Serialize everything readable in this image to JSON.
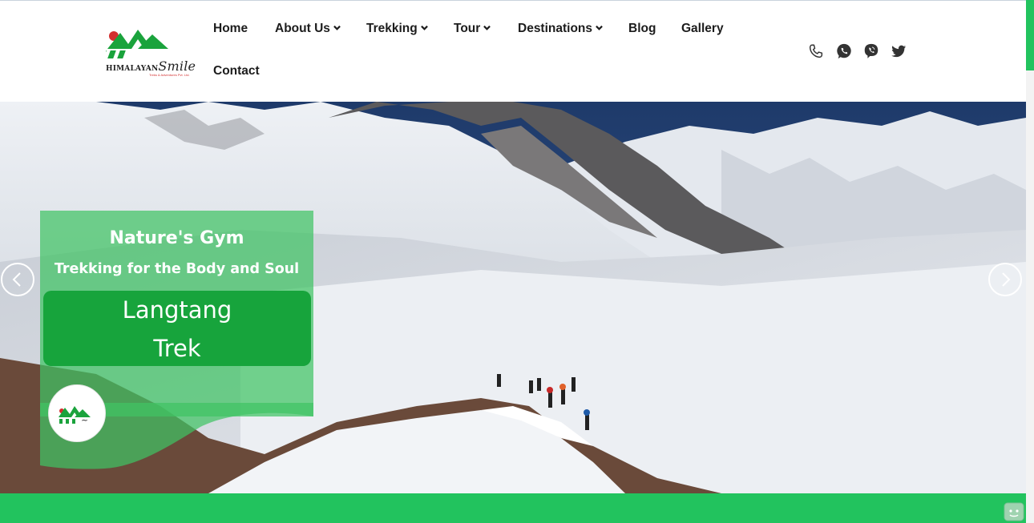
{
  "brand": {
    "name": "HIMALAYAN",
    "name_script": "Smile",
    "tagline": "Treks & Adventures Pvt. Ltd."
  },
  "nav": {
    "items": [
      {
        "label": "Home",
        "dropdown": false
      },
      {
        "label": "About Us",
        "dropdown": true
      },
      {
        "label": "Trekking",
        "dropdown": true
      },
      {
        "label": "Tour",
        "dropdown": true
      },
      {
        "label": "Destinations",
        "dropdown": true
      },
      {
        "label": "Blog",
        "dropdown": false
      },
      {
        "label": "Gallery",
        "dropdown": false
      },
      {
        "label": "Contact",
        "dropdown": false
      }
    ]
  },
  "social": {
    "icons": [
      "phone-icon",
      "whatsapp-icon",
      "viber-icon",
      "twitter-icon"
    ]
  },
  "hero": {
    "title": "Nature's Gym",
    "subtitle": "Trekking for the Body and Soul",
    "trek_line1": "Langtang",
    "trek_line2": "Trek",
    "prev_icon": "chevron-left-icon",
    "next_icon": "chevron-right-icon"
  },
  "colors": {
    "brand_green": "#22c35e",
    "promo_green": "#17a43c",
    "brand_red": "#d32f2f"
  }
}
